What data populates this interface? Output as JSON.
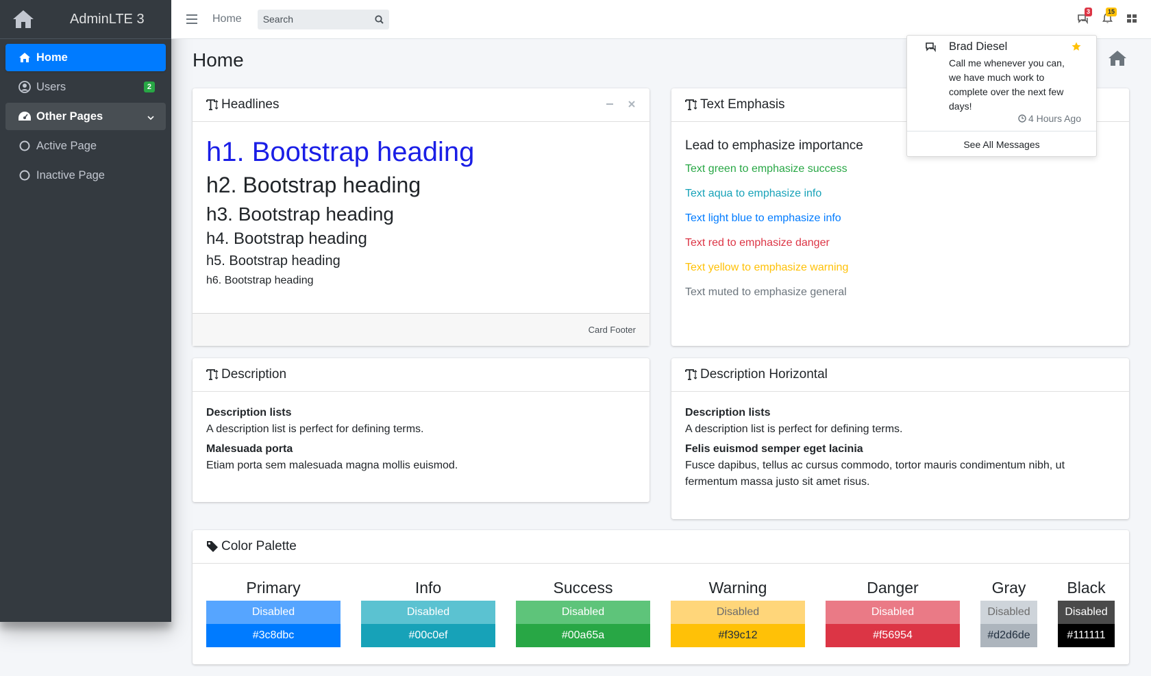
{
  "brand": {
    "name": "AdminLTE 3"
  },
  "sidebar": {
    "items": [
      {
        "label": "Home",
        "icon": "home-icon"
      },
      {
        "label": "Users",
        "icon": "user-circle-icon",
        "badge": "2"
      },
      {
        "label": "Other Pages",
        "icon": "dashboard-icon"
      },
      {
        "label": "Active Page",
        "icon": "circle-icon"
      },
      {
        "label": "Inactive Page",
        "icon": "circle-icon"
      }
    ]
  },
  "topnav": {
    "home_link": "Home",
    "search": {
      "placeholder": "Search",
      "value": ""
    },
    "messages_badge": "3",
    "notifications_badge": "15"
  },
  "page": {
    "title": "Home"
  },
  "headlines_card": {
    "title": "Headlines",
    "h1": "h1. Bootstrap heading",
    "h2": "h2. Bootstrap heading",
    "h3": "h3. Bootstrap heading",
    "h4": "h4. Bootstrap heading",
    "h5": "h5. Bootstrap heading",
    "h6": "h6. Bootstrap heading",
    "footer": "Card Footer"
  },
  "emphasis_card": {
    "title": "Text Emphasis",
    "lead": "Lead to emphasize importance",
    "lines": [
      {
        "text": "Text green to emphasize success",
        "color": "#28a745"
      },
      {
        "text": "Text aqua to emphasize info",
        "color": "#17a2b8"
      },
      {
        "text": "Text light blue to emphasize info",
        "color": "#007bff"
      },
      {
        "text": "Text red to emphasize danger",
        "color": "#dc3545"
      },
      {
        "text": "Text yellow to emphasize warning",
        "color": "#ffc107"
      },
      {
        "text": "Text muted to emphasize general",
        "color": "#6c757d"
      }
    ]
  },
  "description_card": {
    "title": "Description",
    "items": [
      {
        "term": "Description lists",
        "desc": "A description list is perfect for defining terms."
      },
      {
        "term": "Malesuada porta",
        "desc": "Etiam porta sem malesuada magna mollis euismod."
      }
    ]
  },
  "description_h_card": {
    "title": "Description Horizontal",
    "items": [
      {
        "term": "Description lists",
        "desc": "A description list is perfect for defining terms."
      },
      {
        "term": "Felis euismod semper eget lacinia",
        "desc": "Fusce dapibus, tellus ac cursus commodo, tortor mauris condimentum nibh, ut fermentum massa justo sit amet risus."
      }
    ]
  },
  "palette_card": {
    "title": "Color Palette",
    "colors": [
      {
        "name": "Primary",
        "disabled": "Disabled",
        "hex": "#3c8dbc",
        "main": "#007bff",
        "light": "#56a5ff",
        "text_dark": false
      },
      {
        "name": "Info",
        "disabled": "Disabled",
        "hex": "#00c0ef",
        "main": "#17a2b8",
        "light": "#5bc2d1",
        "text_dark": false
      },
      {
        "name": "Success",
        "disabled": "Disabled",
        "hex": "#00a65a",
        "main": "#28a745",
        "light": "#5ec47a",
        "text_dark": false
      },
      {
        "name": "Warning",
        "disabled": "Disabled",
        "hex": "#f39c12",
        "main": "#ffc107",
        "light": "#ffd67a",
        "text_dark": true
      },
      {
        "name": "Danger",
        "disabled": "Disabled",
        "hex": "#f56954",
        "main": "#dc3545",
        "light": "#ea7a86",
        "text_dark": false
      },
      {
        "name": "Gray",
        "disabled": "Disabled",
        "hex": "#d2d6de",
        "main": "#adb5bd",
        "light": "#ced4da",
        "text_dark": true
      },
      {
        "name": "Black",
        "disabled": "Disabled",
        "hex": "#111111",
        "main": "#000000",
        "light": "#4a4a4a",
        "text_dark": false
      }
    ]
  },
  "messages_dropdown": {
    "sender": "Brad Diesel",
    "text": "Call me whenever you can, we have much work to complete over the next few days!",
    "time": "4 Hours Ago",
    "footer": "See All Messages",
    "star_color": "#ffc107"
  }
}
